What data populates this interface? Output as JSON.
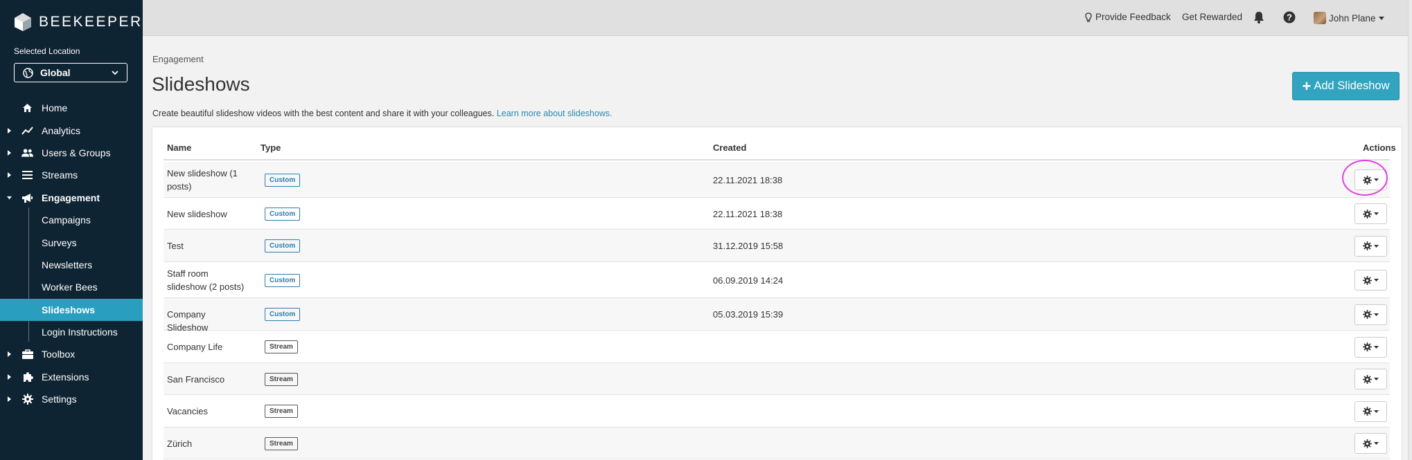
{
  "brand": {
    "name": "BEEKEEPER"
  },
  "location": {
    "label": "Selected Location",
    "value": "Global"
  },
  "nav": [
    {
      "id": "home",
      "label": "Home",
      "icon": "home-icon",
      "caret": false,
      "bold": false
    },
    {
      "id": "analytics",
      "label": "Analytics",
      "icon": "analytics-icon",
      "caret": true,
      "bold": false
    },
    {
      "id": "users-groups",
      "label": "Users & Groups",
      "icon": "users-icon",
      "caret": true,
      "bold": false
    },
    {
      "id": "streams",
      "label": "Streams",
      "icon": "streams-icon",
      "caret": true,
      "bold": false
    },
    {
      "id": "engagement",
      "label": "Engagement",
      "icon": "megaphone-icon",
      "caret": true,
      "expanded": true,
      "bold": true
    },
    {
      "id": "campaigns",
      "label": "Campaigns",
      "sub": true
    },
    {
      "id": "surveys",
      "label": "Surveys",
      "sub": true
    },
    {
      "id": "newsletters",
      "label": "Newsletters",
      "sub": true
    },
    {
      "id": "worker-bees",
      "label": "Worker Bees",
      "sub": true
    },
    {
      "id": "slideshows",
      "label": "Slideshows",
      "sub": true,
      "active": true
    },
    {
      "id": "login-instructions",
      "label": "Login Instructions",
      "sub": true
    },
    {
      "id": "toolbox",
      "label": "Toolbox",
      "icon": "toolbox-icon",
      "caret": true,
      "bold": false
    },
    {
      "id": "extensions",
      "label": "Extensions",
      "icon": "puzzle-icon",
      "caret": true,
      "bold": false
    },
    {
      "id": "settings",
      "label": "Settings",
      "icon": "gear-icon",
      "caret": true,
      "bold": false
    }
  ],
  "header": {
    "feedback": "Provide Feedback",
    "rewarded": "Get Rewarded",
    "user": "John Plane"
  },
  "page": {
    "breadcrumb": "Engagement",
    "title": "Slideshows",
    "description": "Create beautiful slideshow videos with the best content and share it with your colleagues.",
    "learn_more": "Learn more about slideshows.",
    "add_button": "Add Slideshow"
  },
  "table": {
    "headers": {
      "name": "Name",
      "type": "Type",
      "created": "Created",
      "actions": "Actions"
    },
    "rows": [
      {
        "name": "New slideshow (1 posts)",
        "type": "Custom",
        "created": "22.11.2021 18:38"
      },
      {
        "name": "New slideshow",
        "type": "Custom",
        "created": "22.11.2021 18:38"
      },
      {
        "name": "Test",
        "type": "Custom",
        "created": "31.12.2019 15:58"
      },
      {
        "name": "Staff room slideshow (2 posts)",
        "type": "Custom",
        "created": "06.09.2019 14:24"
      },
      {
        "name": "Company Slideshow",
        "type": "Custom",
        "created": "05.03.2019 15:39"
      },
      {
        "name": "Company Life",
        "type": "Stream",
        "created": ""
      },
      {
        "name": "San Francisco",
        "type": "Stream",
        "created": ""
      },
      {
        "name": "Vacancies",
        "type": "Stream",
        "created": ""
      },
      {
        "name": "Zürich",
        "type": "Stream",
        "created": ""
      }
    ]
  },
  "colors": {
    "sidebar": "#0f2433",
    "accent": "#2a9ebf",
    "button": "#33a4bf",
    "highlight": "#e040e0"
  }
}
